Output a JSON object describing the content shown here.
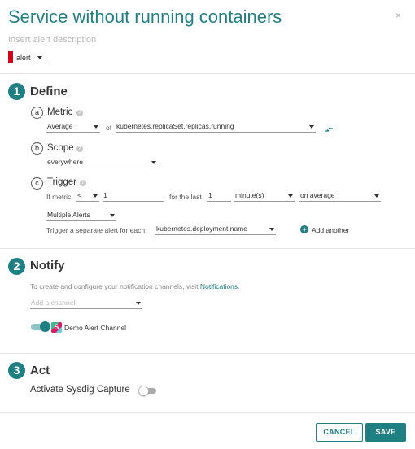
{
  "alert": {
    "title": "Service without running containers",
    "description_placeholder": "Insert alert description",
    "severity": "alert",
    "severity_color": "#d0021b"
  },
  "close_icon": "×",
  "define": {
    "number": "1",
    "title": "Define",
    "metric": {
      "letter": "a",
      "label": "Metric",
      "aggregation": "Average",
      "of_label": "of",
      "name": "kubernetes.replicaSet.replicas.running"
    },
    "scope": {
      "letter": "b",
      "label": "Scope",
      "value": "everywhere"
    },
    "trigger": {
      "letter": "c",
      "label": "Trigger",
      "if_metric_label": "If metric",
      "operator": "<",
      "threshold": "1",
      "for_last_label": "for the last",
      "duration": "1",
      "unit": "minute(s)",
      "aggregation": "on average",
      "mode": "Multiple Alerts",
      "segment_label": "Trigger a separate alert for each",
      "segment_by": "kubernetes.deployment.name",
      "add_another": "Add another"
    }
  },
  "notify": {
    "number": "2",
    "title": "Notify",
    "info_text": "To create and configure your notification channels, visit",
    "info_link": "Notifications",
    "info_end": ".",
    "channel_placeholder": "Add a channel",
    "channel_name": "Demo Alert Channel",
    "channel_enabled": true
  },
  "act": {
    "number": "3",
    "title": "Act",
    "capture_label": "Activate Sysdig Capture",
    "capture_enabled": false
  },
  "footer": {
    "cancel": "CANCEL",
    "save": "SAVE"
  },
  "colors": {
    "accent": "#1f7f83",
    "severity": "#d0021b"
  }
}
